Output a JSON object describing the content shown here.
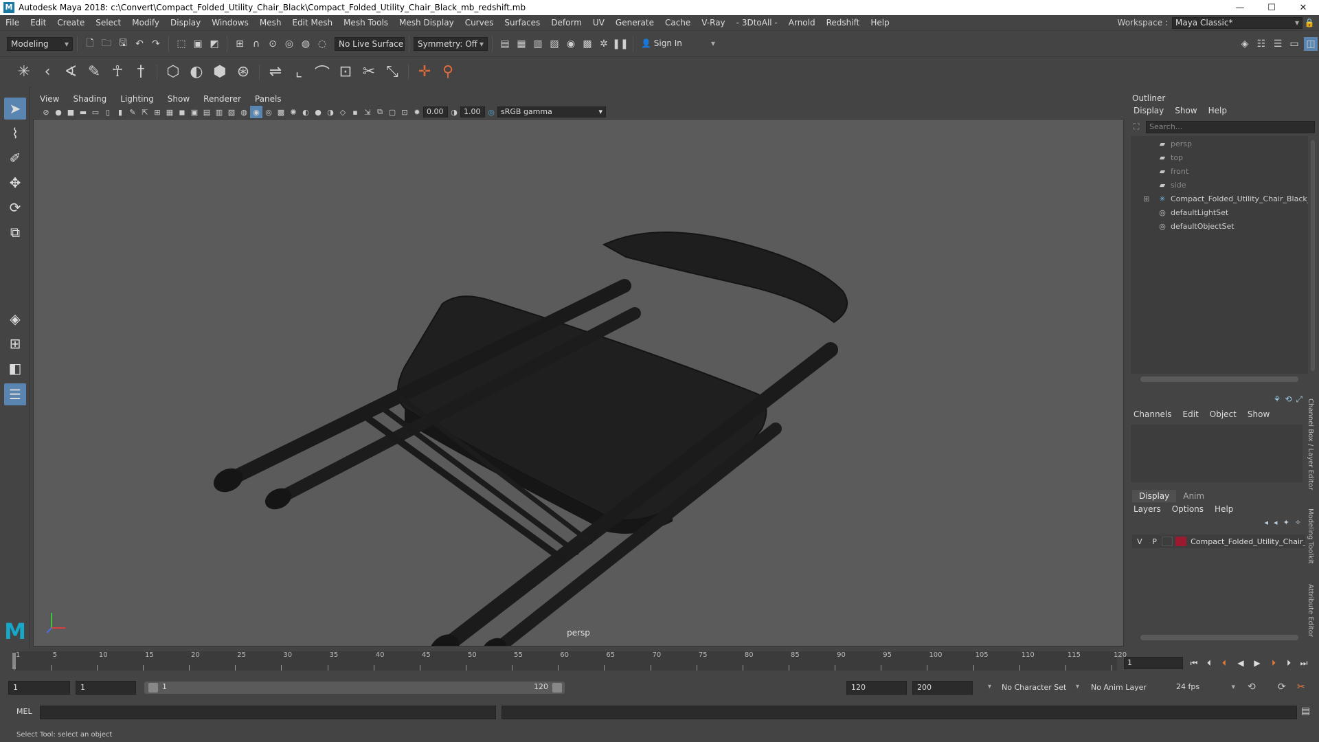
{
  "window": {
    "title": "Autodesk Maya 2018: c:\\Convert\\Compact_Folded_Utility_Chair_Black\\Compact_Folded_Utility_Chair_Black_mb_redshift.mb",
    "logo_letter": "M",
    "minimize": "—",
    "maximize": "☐",
    "close": "✕"
  },
  "menubar": {
    "items": [
      "File",
      "Edit",
      "Create",
      "Select",
      "Modify",
      "Display",
      "Windows",
      "Mesh",
      "Edit Mesh",
      "Mesh Tools",
      "Mesh Display",
      "Curves",
      "Surfaces",
      "Deform",
      "UV",
      "Generate",
      "Cache",
      "V-Ray",
      "- 3DtoAll -",
      "Arnold",
      "Redshift",
      "Help"
    ],
    "workspace_label": "Workspace :",
    "workspace_value": "Maya Classic*"
  },
  "statusline": {
    "mode": "Modeling",
    "live_surface": "No Live Surface",
    "symmetry": "Symmetry: Off",
    "sign_in": "Sign In"
  },
  "viewport": {
    "menus": [
      "View",
      "Shading",
      "Lighting",
      "Show",
      "Renderer",
      "Panels"
    ],
    "exposure": "0.00",
    "gamma": "1.00",
    "color_space": "sRGB gamma",
    "camera_label": "persp"
  },
  "outliner": {
    "title": "Outliner",
    "menus": [
      "Display",
      "Show",
      "Help"
    ],
    "search_placeholder": "Search...",
    "items": [
      {
        "label": "persp",
        "icon": "camera-icon",
        "dim": true
      },
      {
        "label": "top",
        "icon": "camera-icon",
        "dim": true
      },
      {
        "label": "front",
        "icon": "camera-icon",
        "dim": true
      },
      {
        "label": "side",
        "icon": "camera-icon",
        "dim": true
      },
      {
        "label": "Compact_Folded_Utility_Chair_Black_ncl",
        "icon": "group-icon",
        "dim": false
      },
      {
        "label": "defaultLightSet",
        "icon": "set-icon",
        "dim": false
      },
      {
        "label": "defaultObjectSet",
        "icon": "set-icon",
        "dim": false
      }
    ]
  },
  "channelbox": {
    "menus": [
      "Channels",
      "Edit",
      "Object",
      "Show"
    ]
  },
  "layereditor": {
    "tabs": [
      "Display",
      "Anim"
    ],
    "menus": [
      "Layers",
      "Options",
      "Help"
    ],
    "layer": {
      "v": "V",
      "p": "P",
      "name": "Compact_Folded_Utility_Chair_",
      "color": "#9b1a2f"
    }
  },
  "side_tabs": [
    "Channel Box / Layer Editor",
    "Modeling Toolkit",
    "Attribute Editor"
  ],
  "timeslider": {
    "ticks": [
      "1",
      "5",
      "10",
      "15",
      "20",
      "25",
      "30",
      "35",
      "40",
      "45",
      "50",
      "55",
      "60",
      "65",
      "70",
      "75",
      "80",
      "85",
      "90",
      "95",
      "100",
      "105",
      "110",
      "115",
      "120"
    ],
    "current_frame": "1"
  },
  "rangeslider": {
    "start": "1",
    "start_inner": "1",
    "bar_start": "1",
    "bar_end": "120",
    "end_inner": "120",
    "end": "200",
    "character_set": "No Character Set",
    "anim_layer": "No Anim Layer",
    "fps": "24 fps"
  },
  "cmdline": {
    "label": "MEL"
  },
  "helpline": {
    "text": "Select Tool: select an object"
  }
}
